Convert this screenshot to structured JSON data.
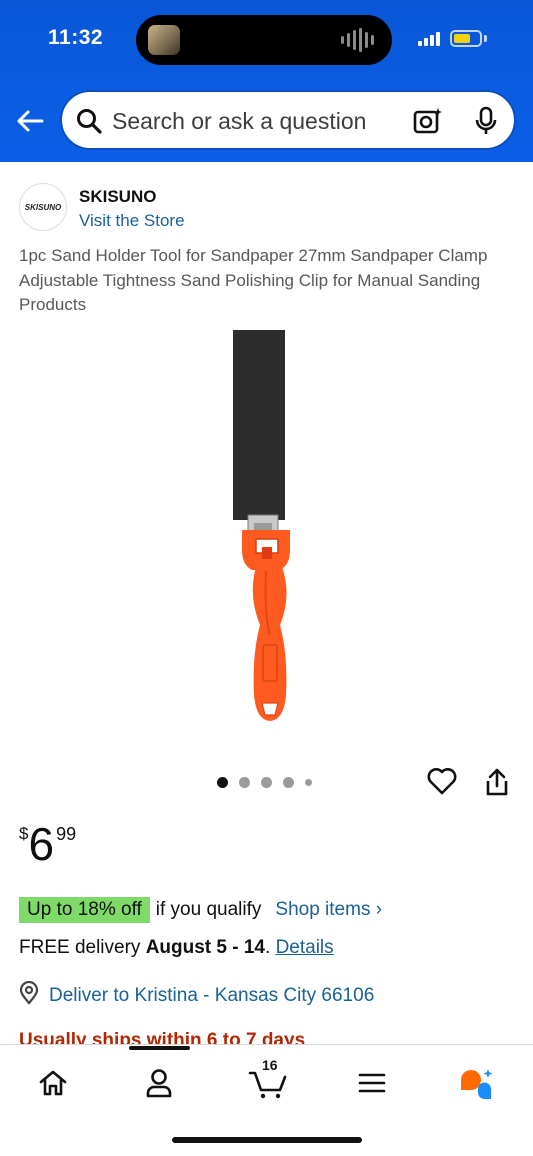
{
  "status_bar": {
    "time": "11:32"
  },
  "search": {
    "placeholder": "Search or ask a question"
  },
  "brand": {
    "name": "SKISUNO",
    "logo_text": "SKISUNO",
    "visit_store": "Visit the Store"
  },
  "product": {
    "title": "1pc Sand Holder Tool for Sandpaper 27mm Sandpaper Clamp Adjustable Tightness Sand Polishing Clip for Manual Sanding Products",
    "image_count": 5,
    "active_image": 1
  },
  "price": {
    "symbol": "$",
    "whole": "6",
    "fraction": "99"
  },
  "deal": {
    "badge": "Up to 18% off",
    "qualify": "if you qualify",
    "shop_items": "Shop items ›"
  },
  "delivery": {
    "prefix": "FREE delivery ",
    "dates": "August 5 - 14",
    "sep": ". ",
    "details": "Details"
  },
  "deliver_to": {
    "label": "Deliver to Kristina - Kansas City 66106"
  },
  "shipping": {
    "text": "Usually ships within 6 to 7 days"
  },
  "nav": {
    "cart_count": "16"
  },
  "colors": {
    "header_blue": "#0b5fe6",
    "link": "#1a6196",
    "deal_green": "#7fda69",
    "ships_red": "#b12704",
    "handle_orange": "#ff5a1f"
  }
}
